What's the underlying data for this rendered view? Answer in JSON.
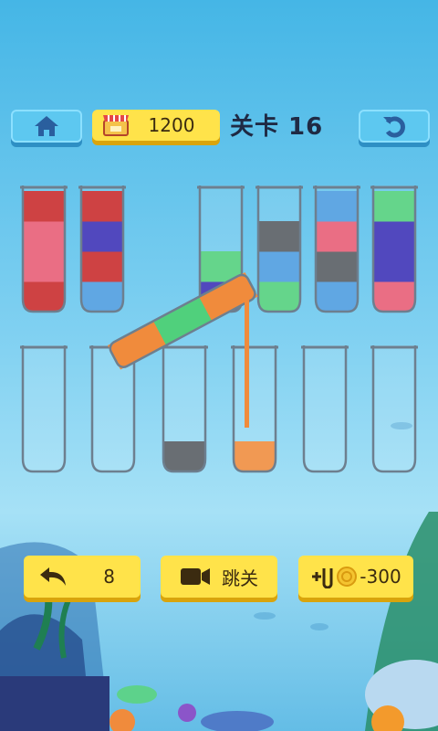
{
  "header": {
    "coins": "1200",
    "level_title": "关卡 16"
  },
  "controls": {
    "undo_count": "8",
    "skip_label": "跳关",
    "add_tube_cost": "-300"
  },
  "colors": {
    "red": "#c8282a",
    "pink": "#e85b74",
    "blue": "#4a9be0",
    "navy": "#3a2fb5",
    "green": "#50d07c",
    "gray": "#555a60",
    "orange": "#f08b3c"
  },
  "tubes": [
    {
      "row": 1,
      "layers_bottom_to_top": [
        "red",
        "pink",
        "pink",
        "red"
      ]
    },
    {
      "row": 1,
      "layers_bottom_to_top": [
        "blue",
        "red",
        "navy",
        "red"
      ]
    },
    {
      "row": 1,
      "layers_bottom_to_top": [
        "navy",
        "green"
      ]
    },
    {
      "row": 1,
      "layers_bottom_to_top": [
        "green",
        "blue",
        "gray"
      ]
    },
    {
      "row": 1,
      "layers_bottom_to_top": [
        "blue",
        "gray",
        "pink",
        "blue"
      ]
    },
    {
      "row": 1,
      "layers_bottom_to_top": [
        "pink",
        "navy",
        "navy",
        "green"
      ]
    },
    {
      "row": 2,
      "layers_bottom_to_top": []
    },
    {
      "row": 2,
      "layers_bottom_to_top": []
    },
    {
      "row": 2,
      "layers_bottom_to_top": [
        "gray"
      ]
    },
    {
      "row": 2,
      "layers_bottom_to_top": [
        "orange"
      ]
    },
    {
      "row": 2,
      "layers_bottom_to_top": []
    },
    {
      "row": 2,
      "layers_bottom_to_top": []
    }
  ],
  "pouring_tube": {
    "layers": [
      "orange",
      "green",
      "orange"
    ],
    "target_tube": 10
  }
}
